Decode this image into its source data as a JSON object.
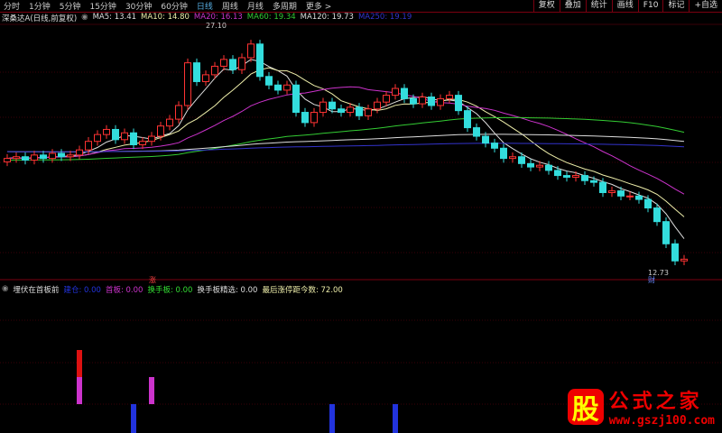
{
  "toolbar": {
    "periods": [
      "分时",
      "1分钟",
      "5分钟",
      "15分钟",
      "30分钟",
      "60分钟",
      "日线",
      "周线",
      "月线",
      "多周期",
      "更多 >"
    ],
    "active": "日线",
    "right": [
      "复权",
      "叠加",
      "统计",
      "画线",
      "F10",
      "标记",
      "+自选"
    ]
  },
  "info": {
    "title": "深桑达A(日线,前复权)",
    "ma": [
      {
        "label": "MA5: 13.41",
        "color": "#dddddd"
      },
      {
        "label": "MA10: 14.80",
        "color": "#eeeeaa"
      },
      {
        "label": "MA20: 16.13",
        "color": "#cc33cc"
      },
      {
        "label": "MA60: 19.34",
        "color": "#33cc33"
      },
      {
        "label": "MA120: 19.73",
        "color": "#dddddd"
      },
      {
        "label": "MA250: 19.19",
        "color": "#3333cc"
      }
    ]
  },
  "price": {
    "high_label": "27.10",
    "low_label": "12.73",
    "max": 27.1,
    "min": 12.73,
    "closes": [
      19.3,
      19.4,
      19.2,
      19.5,
      19.3,
      19.6,
      19.4,
      19.5,
      19.8,
      20.3,
      20.7,
      21.0,
      20.4,
      20.8,
      20.1,
      20.3,
      20.6,
      21.2,
      21.6,
      22.4,
      24.9,
      23.8,
      24.2,
      24.7,
      25.1,
      24.5,
      25.2,
      26.0,
      24.1,
      23.6,
      23.3,
      23.6,
      22.0,
      21.4,
      22.0,
      22.6,
      22.2,
      22.0,
      22.3,
      21.8,
      22.2,
      22.6,
      23.0,
      23.4,
      22.8,
      22.5,
      22.9,
      22.4,
      22.8,
      23.0,
      22.1,
      21.1,
      20.6,
      20.2,
      19.9,
      19.3,
      19.4,
      19.0,
      18.8,
      18.9,
      18.6,
      18.3,
      18.2,
      18.3,
      18.0,
      17.9,
      17.3,
      17.4,
      17.1,
      17.1,
      16.9,
      16.4,
      15.6,
      14.3,
      13.3,
      13.4
    ],
    "highlight_label": "涨",
    "bottom_label": "财"
  },
  "indicator": {
    "name": "埋伏在首板前",
    "items": [
      {
        "label": "建仓: 0.00",
        "color": "#2233dd"
      },
      {
        "label": "首板: 0.00",
        "color": "#cc33cc"
      },
      {
        "label": "换手板: 0.00",
        "color": "#33dd33"
      },
      {
        "label": "换手板精选: 0.00",
        "color": "#dddddd"
      },
      {
        "label": "最后涨停距今数: 72.00",
        "color": "#eeeeaa"
      }
    ],
    "signals": [
      {
        "i": 8,
        "type": "red"
      },
      {
        "i": 8,
        "type": "magenta"
      },
      {
        "i": 16,
        "type": "magenta"
      },
      {
        "i": 14,
        "type": "blue"
      },
      {
        "i": 36,
        "type": "blue"
      },
      {
        "i": 43,
        "type": "blue"
      }
    ]
  },
  "watermark": {
    "badge": "股",
    "title": "公式之家",
    "url": "www.gszj100.com"
  }
}
